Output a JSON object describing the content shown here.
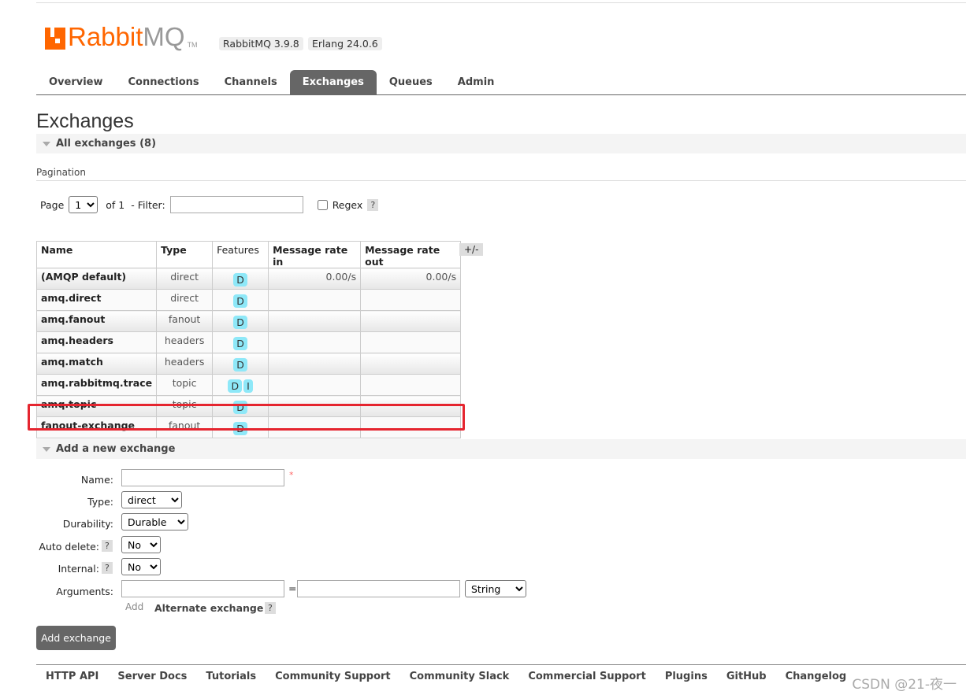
{
  "header": {
    "logo_text_a": "Rabbit",
    "logo_text_b": "MQ",
    "logo_tm": "TM",
    "version_rabbit": "RabbitMQ 3.9.8",
    "version_erlang": "Erlang 24.0.6"
  },
  "nav": [
    {
      "label": "Overview"
    },
    {
      "label": "Connections"
    },
    {
      "label": "Channels"
    },
    {
      "label": "Exchanges",
      "active": true
    },
    {
      "label": "Queues"
    },
    {
      "label": "Admin"
    }
  ],
  "page_title": "Exchanges",
  "all_section": "All exchanges (8)",
  "pagination": {
    "label": "Pagination",
    "page_label": "Page",
    "page_value": "1",
    "of_label": "of 1",
    "filter_label": "- Filter:",
    "filter_value": "",
    "regex_label": "Regex",
    "help": "?"
  },
  "table": {
    "headers": [
      "Name",
      "Type",
      "Features",
      "Message rate in",
      "Message rate out"
    ],
    "toggle": "+/-",
    "rows": [
      {
        "name": "(AMQP default)",
        "type": "direct",
        "features": [
          "D"
        ],
        "rate_in": "0.00/s",
        "rate_out": "0.00/s"
      },
      {
        "name": "amq.direct",
        "type": "direct",
        "features": [
          "D"
        ],
        "rate_in": "",
        "rate_out": ""
      },
      {
        "name": "amq.fanout",
        "type": "fanout",
        "features": [
          "D"
        ],
        "rate_in": "",
        "rate_out": ""
      },
      {
        "name": "amq.headers",
        "type": "headers",
        "features": [
          "D"
        ],
        "rate_in": "",
        "rate_out": ""
      },
      {
        "name": "amq.match",
        "type": "headers",
        "features": [
          "D"
        ],
        "rate_in": "",
        "rate_out": ""
      },
      {
        "name": "amq.rabbitmq.trace",
        "type": "topic",
        "features": [
          "D",
          "I"
        ],
        "rate_in": "",
        "rate_out": ""
      },
      {
        "name": "amq.topic",
        "type": "topic",
        "features": [
          "D"
        ],
        "rate_in": "",
        "rate_out": ""
      },
      {
        "name": "fanout-exchange",
        "type": "fanout",
        "features": [
          "D"
        ],
        "rate_in": "",
        "rate_out": ""
      }
    ]
  },
  "add_section": "Add a new exchange",
  "form": {
    "name_label": "Name:",
    "name_value": "",
    "required": "*",
    "type_label": "Type:",
    "type_value": "direct",
    "durability_label": "Durability:",
    "durability_value": "Durable",
    "auto_delete_label": "Auto delete:",
    "auto_delete_value": "No",
    "internal_label": "Internal:",
    "internal_value": "No",
    "arguments_label": "Arguments:",
    "eq": "=",
    "arg_type": "String",
    "add_link": "Add",
    "alt_exchange": "Alternate exchange",
    "help": "?",
    "submit": "Add exchange"
  },
  "footer": [
    "HTTP API",
    "Server Docs",
    "Tutorials",
    "Community Support",
    "Community Slack",
    "Commercial Support",
    "Plugins",
    "GitHub",
    "Changelog"
  ],
  "watermark": "CSDN @21-夜一"
}
